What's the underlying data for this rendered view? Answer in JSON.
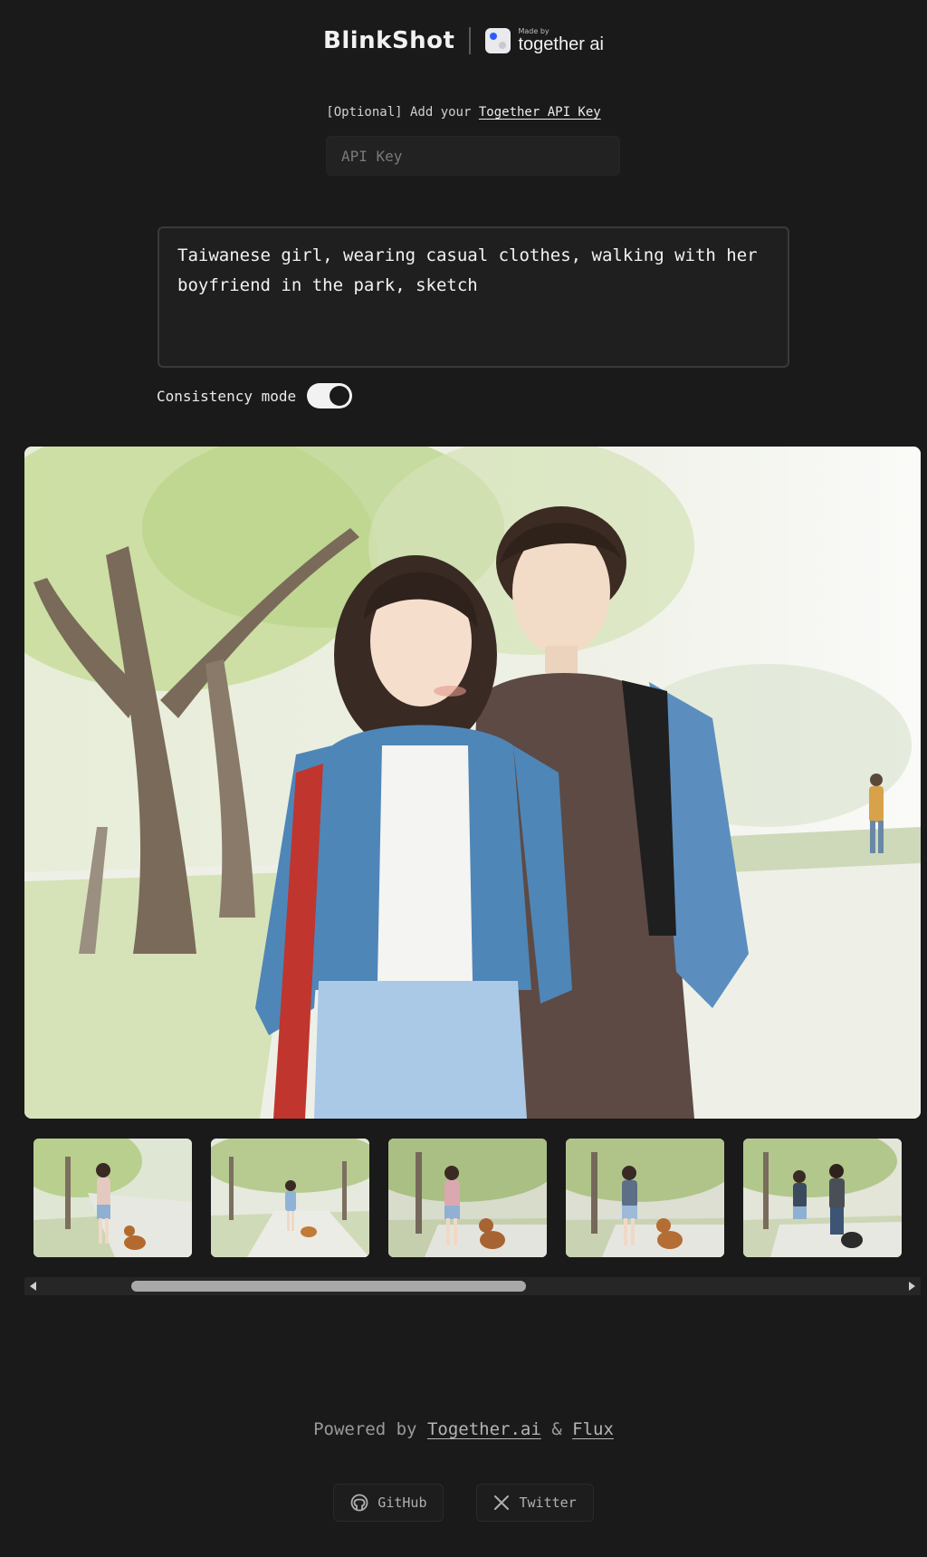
{
  "header": {
    "brand": "BlinkShot",
    "made_by_small": "Made by",
    "made_by_name": "together ai"
  },
  "api_key": {
    "label_prefix": "[Optional] Add your",
    "label_link": "Together API Key",
    "placeholder": "API Key",
    "value": ""
  },
  "prompt": {
    "value": "Taiwanese girl, wearing casual clothes, walking with her boyfriend in the park, sketch"
  },
  "consistency": {
    "label": "Consistency mode",
    "enabled": true
  },
  "gallery": {
    "main_icon": "generated-image",
    "thumbnail_count": 5,
    "scroll_position": 0.19
  },
  "footer": {
    "powered_prefix": "Powered by",
    "together_link": "Together.ai",
    "ampersand": "&",
    "flux_link": "Flux",
    "github_label": "GitHub",
    "twitter_label": "Twitter"
  },
  "colors": {
    "background": "#1a1a1a",
    "text": "#e6e6e6",
    "toggle_on": "#f2f2f2",
    "muted": "#9a9a9a"
  }
}
